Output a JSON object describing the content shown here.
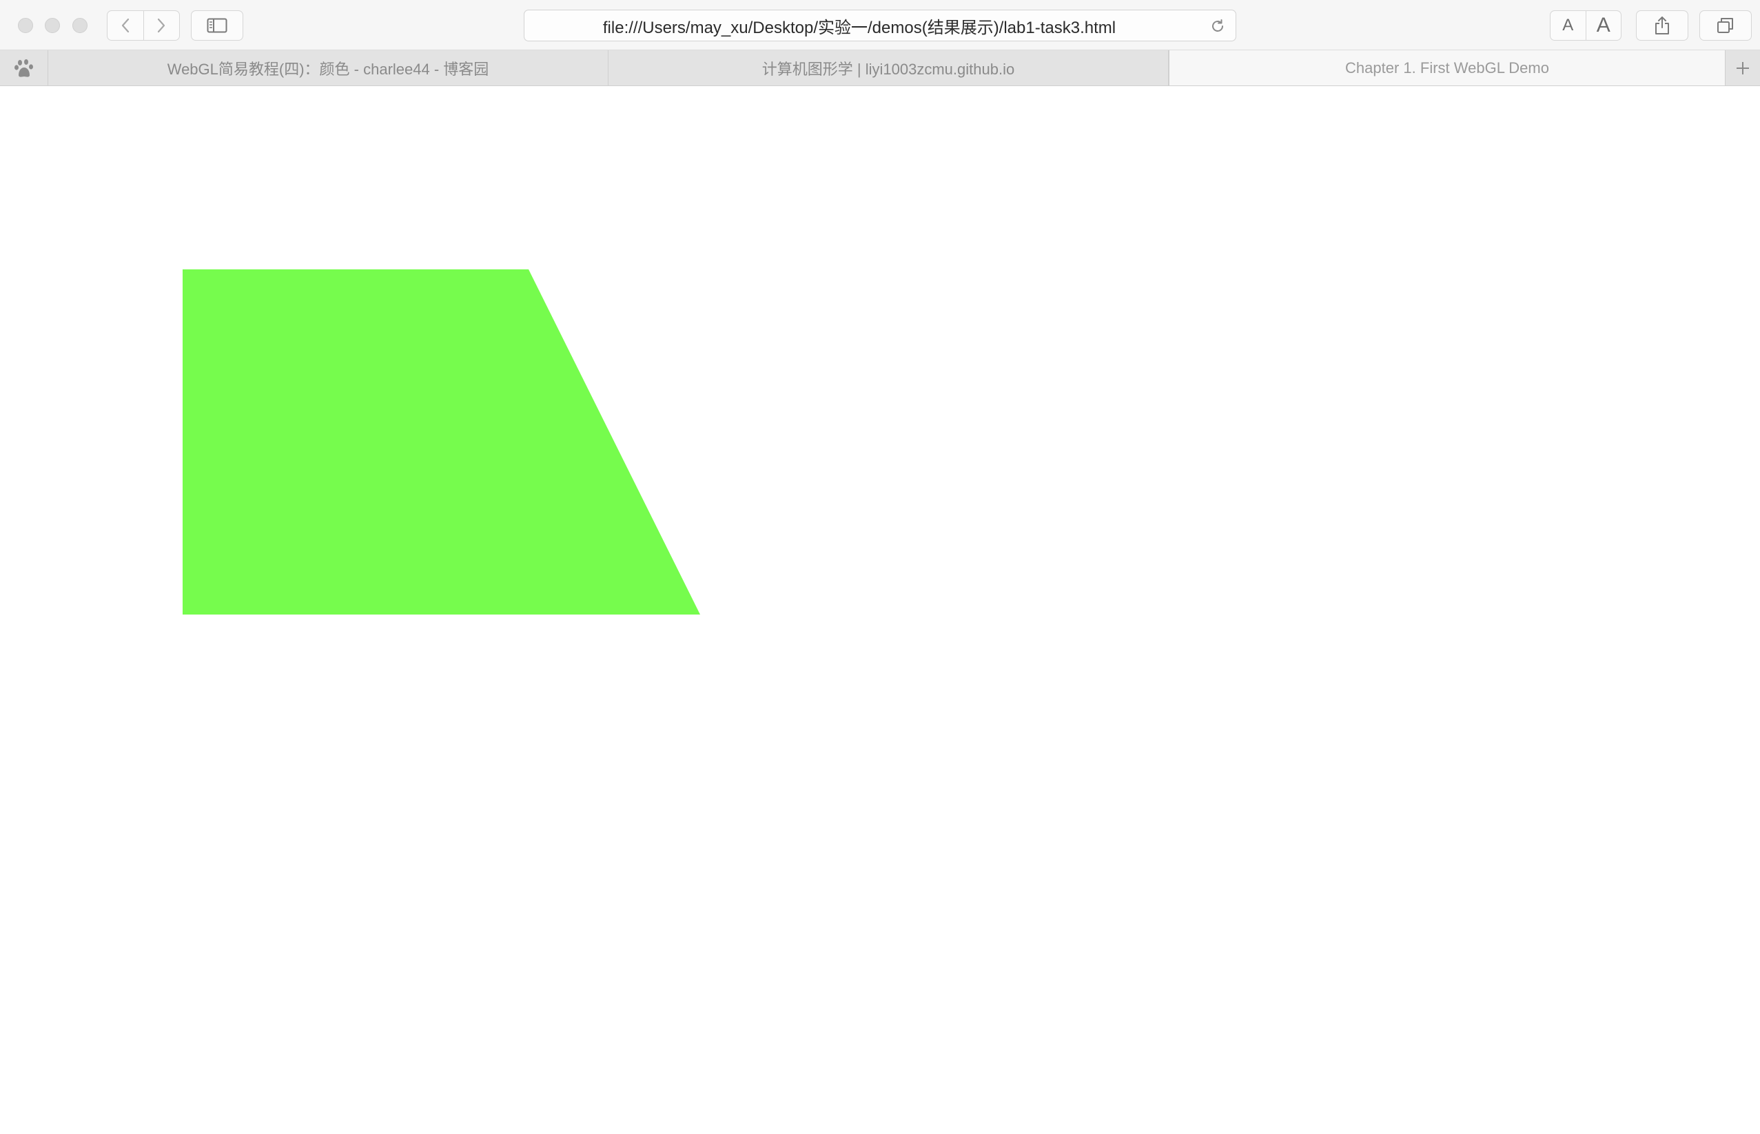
{
  "toolbar": {
    "address": "file:///Users/may_xu/Desktop/实验一/demos(结果展示)/lab1-task3.html",
    "font_small_label": "A",
    "font_large_label": "A",
    "icons": {
      "back": "chevron-left-icon",
      "forward": "chevron-right-icon",
      "sidebar": "sidebar-icon",
      "reload": "reload-icon",
      "share": "share-icon",
      "tabs": "tab-overview-icon"
    }
  },
  "tabs": [
    {
      "title": "WebGL简易教程(四)：颜色 - charlee44 - 博客园",
      "active": false
    },
    {
      "title": "计算机图形学 | liyi1003zcmu.github.io",
      "active": false
    },
    {
      "title": "Chapter 1. First WebGL Demo",
      "active": true
    }
  ],
  "pinned_tab": {
    "icon": "baidu-paw-icon"
  },
  "canvas": {
    "background": "#ffffff",
    "shape": "trapezoid",
    "fill_color": "#76fc4d"
  }
}
